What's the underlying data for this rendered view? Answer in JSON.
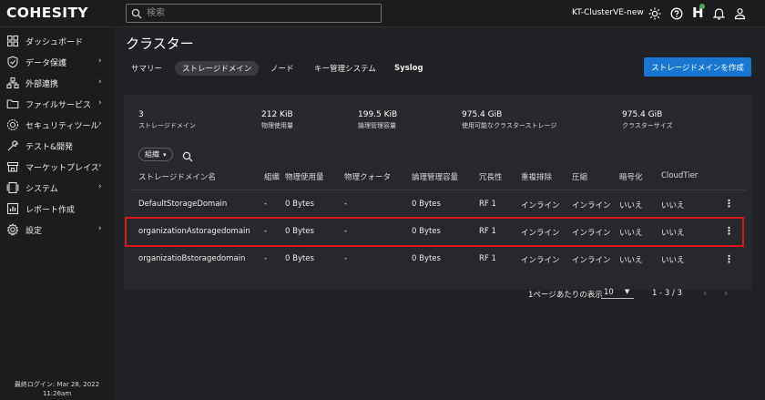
{
  "header": {
    "logo": "COHESITY",
    "search_placeholder": "検索",
    "cluster_name": "KT-ClusterVE-new",
    "helios": "H"
  },
  "sidebar": {
    "items": [
      {
        "label": "ダッシュボード",
        "icon": "dashboard-icon",
        "chevron": ""
      },
      {
        "label": "データ保護",
        "icon": "shield-icon",
        "chevron": "›"
      },
      {
        "label": "外部連携",
        "icon": "network-icon",
        "chevron": "›"
      },
      {
        "label": "ファイルサービス",
        "icon": "folder-icon",
        "chevron": "›"
      },
      {
        "label": "セキュリティツール",
        "icon": "security-icon",
        "chevron": "›"
      },
      {
        "label": "テスト&開発",
        "icon": "tools-icon",
        "chevron": ""
      },
      {
        "label": "マーケットプレイス",
        "icon": "marketplace-icon",
        "chevron": "›"
      },
      {
        "label": "システム",
        "icon": "system-icon",
        "chevron": "›"
      },
      {
        "label": "レポート作成",
        "icon": "report-icon",
        "chevron": ""
      },
      {
        "label": "設定",
        "icon": "gear-icon",
        "chevron": "›"
      }
    ],
    "last_login_line1": "最終ログイン: Mar 28, 2022",
    "last_login_line2": "11:26am"
  },
  "page": {
    "title": "クラスター",
    "tabs": [
      {
        "label": "サマリー",
        "active": false
      },
      {
        "label": "ストレージドメイン",
        "active": true
      },
      {
        "label": "ノード",
        "active": false
      },
      {
        "label": "キー管理システム",
        "active": false
      },
      {
        "label": "Syslog",
        "active": false
      }
    ],
    "create_button": "ストレージドメインを作成"
  },
  "stats": [
    {
      "value": "3",
      "label": "ストレージドメイン"
    },
    {
      "value": "212 KiB",
      "label": "物理使用量"
    },
    {
      "value": "199.5 KiB",
      "label": "論理管理容量"
    },
    {
      "value": "975.4 GiB",
      "label": "使用可能なクラスターストレージ"
    },
    {
      "value": "975.4 GiB",
      "label": "クラスターサイズ"
    }
  ],
  "filter": {
    "chip_label": "組織",
    "chip_caret": "▾"
  },
  "table": {
    "headers": [
      "ストレージドメイン名",
      "組織",
      "物理使用量",
      "物理クォータ",
      "論理管理容量",
      "冗長性",
      "重複排除",
      "圧縮",
      "暗号化",
      "CloudTier"
    ],
    "rows": [
      [
        "DefaultStorageDomain",
        "-",
        "0 Bytes",
        "-",
        "0 Bytes",
        "RF 1",
        "インライン",
        "インライン",
        "いいえ",
        "いいえ"
      ],
      [
        "organizationAstoragedomain",
        "-",
        "0 Bytes",
        "-",
        "0 Bytes",
        "RF 1",
        "インライン",
        "インライン",
        "いいえ",
        "いいえ"
      ],
      [
        "organizatioBstoragedomain",
        "-",
        "0 Bytes",
        "-",
        "0 Bytes",
        "RF 1",
        "インライン",
        "インライン",
        "いいえ",
        "いいえ"
      ]
    ],
    "kebab": "⋮"
  },
  "pagination": {
    "per_page_label": "1ページあたりの表示",
    "per_page_value": "10",
    "range": "1 - 3 / 3",
    "prev": "‹",
    "next": "›"
  },
  "colors": {
    "accent": "#1977d2",
    "highlight": "#d6161d",
    "background": "#202124"
  }
}
